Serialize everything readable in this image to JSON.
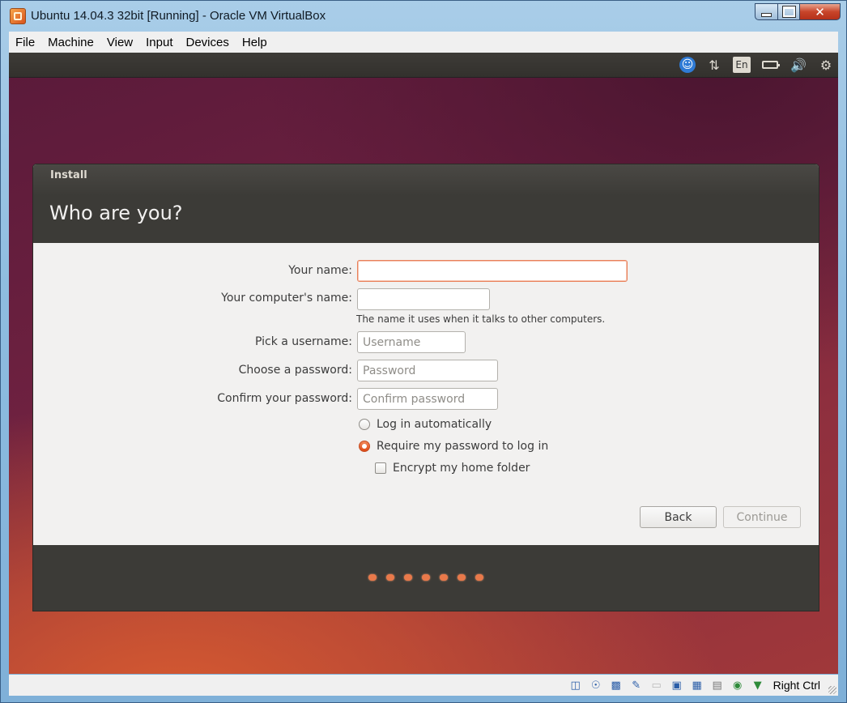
{
  "window": {
    "title": "Ubuntu 14.04.3 32bit [Running] - Oracle VM VirtualBox",
    "controls": {
      "minimize": "minimize-icon",
      "maximize": "maximize-icon",
      "close": "✕"
    }
  },
  "menu": [
    "File",
    "Machine",
    "View",
    "Input",
    "Devices",
    "Help"
  ],
  "top_panel": {
    "icons": [
      "accessibility-icon",
      "network-icon",
      "keyboard-layout-icon",
      "battery-icon",
      "volume-icon",
      "gear-icon"
    ],
    "keyboard_layout": "En"
  },
  "installer": {
    "window_title": "Install",
    "heading": "Who are you?",
    "fields": {
      "name": {
        "label": "Your name:",
        "value": ""
      },
      "computer": {
        "label": "Your computer's name:",
        "value": "",
        "hint": "The name it uses when it talks to other computers."
      },
      "username": {
        "label": "Pick a username:",
        "placeholder": "Username"
      },
      "password": {
        "label": "Choose a password:",
        "placeholder": "Password"
      },
      "confirm": {
        "label": "Confirm your password:",
        "placeholder": "Confirm password"
      }
    },
    "options": {
      "auto_login": "Log in automatically",
      "require_password": "Require my password to log in",
      "encrypt_home": "Encrypt my home folder",
      "selected": "require_password",
      "encrypt_checked": false
    },
    "buttons": {
      "back": "Back",
      "continue": "Continue"
    },
    "progress_dots": 7
  },
  "statusbar": {
    "icons": [
      "hard-disk-icon",
      "optical-drive-icon",
      "usb-icon",
      "shared-folders-icon",
      "folder-icon",
      "display-icon",
      "network-adapters-icon",
      "cpu-icon",
      "capture-icon",
      "mouse-integration-icon"
    ],
    "host_key": "Right Ctrl"
  }
}
